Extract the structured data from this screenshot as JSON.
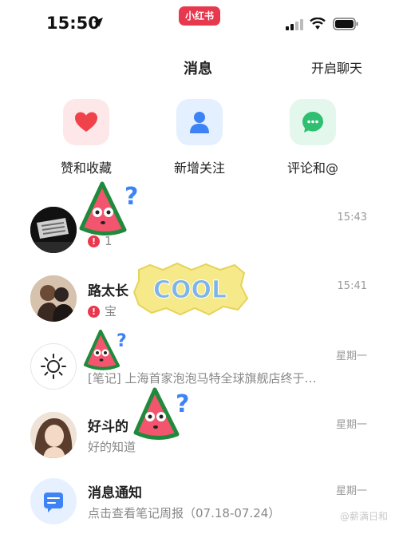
{
  "status_bar": {
    "time": "15:50",
    "app_badge": "小红书"
  },
  "header": {
    "title": "消息",
    "start_chat": "开启聊天"
  },
  "quick_actions": [
    {
      "label": "赞和收藏",
      "icon": "heart-icon"
    },
    {
      "label": "新增关注",
      "icon": "person-icon"
    },
    {
      "label": "评论和@",
      "icon": "comment-icon"
    }
  ],
  "messages": [
    {
      "title": "",
      "preview": "1",
      "time": "15:43",
      "alert": true
    },
    {
      "title": "路太长",
      "preview": "宝",
      "time": "15:41",
      "alert": true
    },
    {
      "title": "",
      "preview": "[笔记] 上海首家泡泡马特全球旗舰店终于…",
      "time": "星期一",
      "alert": false
    },
    {
      "title": "好斗的",
      "preview": "好的知道",
      "time": "星期一",
      "alert": false
    },
    {
      "title": "消息通知",
      "preview": "点击查看笔记周报（07.18-07.24）",
      "time": "星期一",
      "alert": false
    }
  ],
  "sticker_text": "COOL",
  "watermark": "@薪满日和",
  "colors": {
    "brand": "#e8384d",
    "heart_bg": "#fde7e8",
    "person_bg": "#e4efff",
    "comment_bg": "#e3f7ec"
  }
}
